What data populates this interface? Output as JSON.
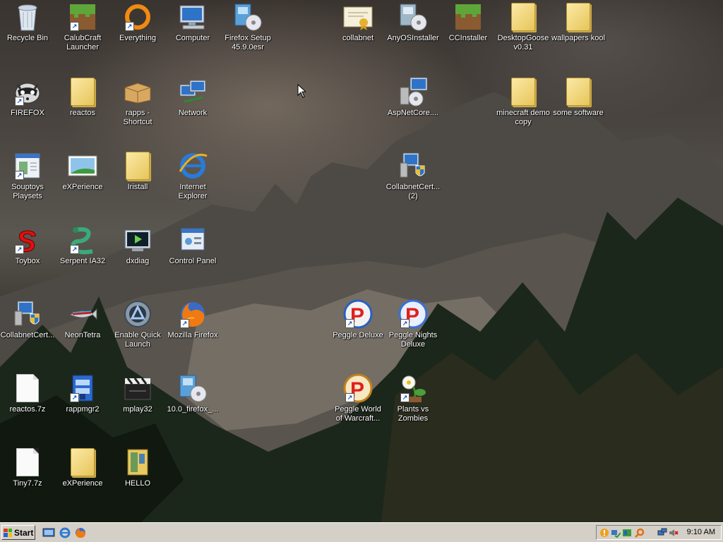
{
  "desktop": {
    "icons": [
      {
        "label": "Recycle Bin",
        "icon": "recycle-bin-icon"
      },
      {
        "label": "CalubCraft Launcher",
        "icon": "grass-block-icon"
      },
      {
        "label": "Everything",
        "icon": "everything-ring-icon"
      },
      {
        "label": "Computer",
        "icon": "computer-icon"
      },
      {
        "label": "Firefox Setup 45.9.0esr",
        "icon": "installer-icon"
      },
      {
        "label": "collabnet",
        "icon": "certificate-icon"
      },
      {
        "label": "AnyOSInstaller",
        "icon": "installer-icon"
      },
      {
        "label": "CCInstaller",
        "icon": "grass-block-icon"
      },
      {
        "label": "DesktopGoose v0.31",
        "icon": "folder-icon"
      },
      {
        "label": "wallpapers kool",
        "icon": "folder-icon"
      },
      {
        "label": "FIREFOX",
        "icon": "raccoon-icon"
      },
      {
        "label": "reactos",
        "icon": "folder-icon"
      },
      {
        "label": "rapps - Shortcut",
        "icon": "package-box-icon"
      },
      {
        "label": "Network",
        "icon": "network-icon"
      },
      {
        "label": "AspNetCore....",
        "icon": "setup-computer-icon"
      },
      {
        "label": "minecraft demo copy",
        "icon": "folder-icon"
      },
      {
        "label": "some software",
        "icon": "folder-icon"
      },
      {
        "label": "Souptoys Playsets",
        "icon": "app-window-icon"
      },
      {
        "label": "eXPerience",
        "icon": "landscape-picture-icon"
      },
      {
        "label": "Iristall",
        "icon": "folder-icon"
      },
      {
        "label": "Internet Explorer",
        "icon": "internet-explorer-icon"
      },
      {
        "label": "CollabnetCert... (2)",
        "icon": "shield-computer-icon"
      },
      {
        "label": "Toybox",
        "icon": "toybox-s-icon"
      },
      {
        "label": "Serpent IA32",
        "icon": "serpent-icon"
      },
      {
        "label": "dxdiag",
        "icon": "dxdiag-icon"
      },
      {
        "label": "Control Panel",
        "icon": "control-panel-icon"
      },
      {
        "label": "CollabnetCert...",
        "icon": "shield-computer-icon"
      },
      {
        "label": "NeonTetra",
        "icon": "neon-tetra-icon"
      },
      {
        "label": "Enable Quick Launch",
        "icon": "quick-launch-icon"
      },
      {
        "label": "Mozilla Firefox",
        "icon": "firefox-icon"
      },
      {
        "label": "Peggle Deluxe",
        "icon": "peggle-icon"
      },
      {
        "label": "Peggle Nights Deluxe",
        "icon": "peggle-icon"
      },
      {
        "label": "reactos.7z",
        "icon": "file-icon"
      },
      {
        "label": "rappmgr2",
        "icon": "rapps-manager-icon"
      },
      {
        "label": "mplay32",
        "icon": "clapperboard-icon"
      },
      {
        "label": "10.0_firefox_...",
        "icon": "installer-icon"
      },
      {
        "label": "Peggle World of Warcraft...",
        "icon": "peggle-icon"
      },
      {
        "label": "Plants vs Zombies",
        "icon": "flower-icon"
      },
      {
        "label": "Tiny7.7z",
        "icon": "file-icon"
      },
      {
        "label": "eXPerience",
        "icon": "folder-icon"
      },
      {
        "label": "HELLO",
        "icon": "book-icon"
      }
    ]
  },
  "taskbar": {
    "start_label": "Start",
    "quick_launch": [
      "show-desktop-icon",
      "internet-explorer-icon",
      "firefox-icon"
    ],
    "tray_icons": [
      "warning-icon",
      "network-status-icon",
      "security-icon",
      "search-icon",
      "network-computer-icon",
      "volume-muted-icon"
    ],
    "clock": "9:10 AM"
  },
  "colors": {
    "taskbar": "#d4d0c8",
    "label_text": "#ffffff"
  }
}
